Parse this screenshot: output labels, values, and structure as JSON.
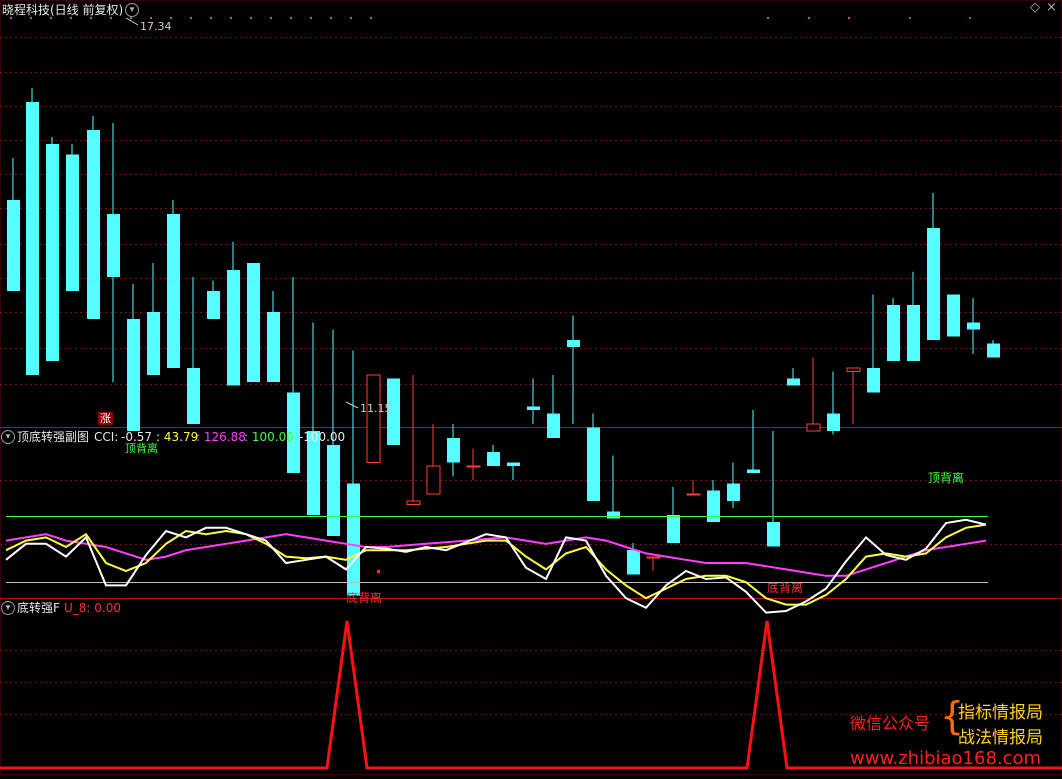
{
  "main": {
    "title": "晓程科技(日线 前复权)",
    "high_label": "17.34",
    "low_label": "11.15",
    "zhang_label": "涨",
    "candles": [
      [
        6,
        20,
        32,
        5,
        -6
      ],
      [
        25,
        48,
        52,
        22,
        -30
      ],
      [
        45,
        36,
        38,
        27,
        -26
      ],
      [
        65,
        33,
        36,
        12,
        -6
      ],
      [
        86,
        40,
        44,
        -10,
        -14
      ],
      [
        106,
        16,
        42,
        -32,
        -2
      ],
      [
        126,
        -14,
        -4,
        -43,
        -46
      ],
      [
        146,
        -12,
        2,
        -3,
        -30
      ],
      [
        166,
        16,
        20,
        0,
        -28
      ],
      [
        186,
        -28,
        -2,
        -34,
        -44
      ],
      [
        206,
        -6,
        -8,
        -3,
        -14
      ],
      [
        226,
        0,
        8,
        -11,
        -33
      ],
      [
        246,
        2,
        -2,
        -5,
        -32
      ],
      [
        266,
        -12,
        -6,
        -16,
        -32
      ],
      [
        286,
        -35,
        -2,
        -34,
        -58
      ],
      [
        306,
        -46,
        -15,
        -56,
        -70
      ],
      [
        326,
        -50,
        -17,
        -63,
        -76
      ],
      [
        346,
        -61,
        -23,
        -47,
        -93
      ],
      [
        366,
        -55,
        -43,
        -54,
        -30
      ],
      [
        386,
        -31,
        -49,
        -31,
        -50
      ],
      [
        406,
        -67,
        -30,
        -56,
        -66
      ],
      [
        426,
        -64,
        -46,
        -44,
        -56
      ],
      [
        446,
        -48,
        -44,
        -59,
        -55
      ],
      [
        466,
        -56,
        -51,
        -60,
        -56
      ],
      [
        486,
        -52,
        -55,
        -50,
        -56
      ],
      [
        506,
        -55,
        -60,
        -60,
        -56
      ],
      [
        526,
        -39,
        -31,
        -44,
        -40
      ],
      [
        546,
        -41,
        -30,
        -38,
        -48
      ],
      [
        566,
        -20,
        -13,
        -44,
        -22
      ],
      [
        586,
        -45,
        -54,
        -41,
        -66
      ],
      [
        606,
        -69,
        -58,
        -53,
        -71
      ],
      [
        626,
        -80,
        -82,
        -78,
        -87
      ],
      [
        646,
        -82,
        -85,
        -86,
        -82
      ],
      [
        666,
        -70,
        -62,
        -64,
        -78
      ],
      [
        686,
        -64,
        -60,
        -63,
        -64
      ],
      [
        706,
        -63,
        -61,
        -60,
        -72
      ],
      [
        726,
        -61,
        -55,
        -68,
        -66
      ],
      [
        746,
        -57,
        -40,
        -56,
        -58
      ],
      [
        766,
        -72,
        -46,
        -62,
        -79
      ],
      [
        786,
        -31,
        -33,
        -28,
        -33
      ],
      [
        806,
        -46,
        -25,
        -35,
        -44
      ],
      [
        826,
        -41,
        -29,
        -47,
        -46
      ],
      [
        846,
        -29,
        -44,
        -31,
        -28
      ],
      [
        866,
        -28,
        -7,
        -18,
        -35
      ],
      [
        886,
        -10,
        -20,
        -8,
        -26
      ],
      [
        906,
        -10,
        -0.5,
        -15,
        -26
      ],
      [
        926,
        12,
        22,
        13,
        -20
      ],
      [
        946,
        -7,
        -10,
        -17,
        -19
      ],
      [
        966,
        -15,
        -8,
        -24,
        -17
      ],
      [
        986,
        -21,
        -24,
        -20,
        -25
      ]
    ]
  },
  "indicator": {
    "title": "顶底转强副图",
    "cci_label": "CCI:",
    "cci_value": "-0.57",
    "v1": ": 43.79",
    "v2": ": 126.88",
    "v3": ": 100.00",
    "v4": ": -100.00",
    "top_div_label": "顶背离",
    "top_div_label_clipped": "顶背离",
    "bottom_div_label_1": "底背离",
    "bottom_div_label_2": "底背离",
    "white_line": [
      [
        6,
        -28
      ],
      [
        26,
        -18
      ],
      [
        46,
        -18
      ],
      [
        66,
        -26
      ],
      [
        86,
        -14
      ],
      [
        106,
        -44
      ],
      [
        126,
        -44
      ],
      [
        146,
        -25
      ],
      [
        166,
        -10
      ],
      [
        186,
        -14
      ],
      [
        206,
        -8
      ],
      [
        226,
        -8
      ],
      [
        246,
        -12
      ],
      [
        266,
        -16
      ],
      [
        286,
        -30
      ],
      [
        306,
        -28
      ],
      [
        326,
        -26
      ],
      [
        346,
        -34
      ],
      [
        366,
        -20
      ],
      [
        386,
        -21
      ],
      [
        406,
        -23
      ],
      [
        426,
        -20
      ],
      [
        446,
        -22
      ],
      [
        466,
        -17
      ],
      [
        486,
        -12
      ],
      [
        506,
        -14
      ],
      [
        526,
        -33
      ],
      [
        546,
        -40
      ],
      [
        566,
        -14
      ],
      [
        586,
        -16
      ],
      [
        606,
        -38
      ],
      [
        626,
        -52
      ],
      [
        646,
        -58
      ],
      [
        666,
        -44
      ],
      [
        686,
        -35
      ],
      [
        706,
        -40
      ],
      [
        726,
        -39
      ],
      [
        746,
        -48
      ],
      [
        766,
        -61
      ],
      [
        786,
        -60
      ],
      [
        806,
        -54
      ],
      [
        826,
        -46
      ],
      [
        846,
        -29
      ],
      [
        866,
        -14
      ],
      [
        886,
        -25
      ],
      [
        906,
        -28
      ],
      [
        926,
        -21
      ],
      [
        946,
        -5
      ],
      [
        966,
        -3
      ],
      [
        986,
        -6
      ]
    ],
    "yellow_line": [
      [
        6,
        -22
      ],
      [
        26,
        -16
      ],
      [
        46,
        -14
      ],
      [
        66,
        -20
      ],
      [
        86,
        -12
      ],
      [
        106,
        -30
      ],
      [
        126,
        -35
      ],
      [
        146,
        -30
      ],
      [
        166,
        -18
      ],
      [
        186,
        -10
      ],
      [
        206,
        -12
      ],
      [
        226,
        -10
      ],
      [
        246,
        -12
      ],
      [
        266,
        -18
      ],
      [
        286,
        -26
      ],
      [
        306,
        -27
      ],
      [
        326,
        -26
      ],
      [
        346,
        -28
      ],
      [
        366,
        -22
      ],
      [
        386,
        -22
      ],
      [
        406,
        -22
      ],
      [
        426,
        -21
      ],
      [
        446,
        -20
      ],
      [
        466,
        -18
      ],
      [
        486,
        -16
      ],
      [
        506,
        -16
      ],
      [
        526,
        -26
      ],
      [
        546,
        -34
      ],
      [
        566,
        -24
      ],
      [
        586,
        -20
      ],
      [
        606,
        -34
      ],
      [
        626,
        -44
      ],
      [
        646,
        -52
      ],
      [
        666,
        -46
      ],
      [
        686,
        -40
      ],
      [
        706,
        -38
      ],
      [
        726,
        -38
      ],
      [
        746,
        -42
      ],
      [
        766,
        -52
      ],
      [
        786,
        -56
      ],
      [
        806,
        -56
      ],
      [
        826,
        -50
      ],
      [
        846,
        -40
      ],
      [
        866,
        -26
      ],
      [
        886,
        -24
      ],
      [
        906,
        -26
      ],
      [
        926,
        -24
      ],
      [
        946,
        -14
      ],
      [
        966,
        -8
      ],
      [
        986,
        -6
      ]
    ],
    "magenta_line": [
      [
        6,
        -16
      ],
      [
        26,
        -14
      ],
      [
        46,
        -12
      ],
      [
        66,
        -16
      ],
      [
        86,
        -18
      ],
      [
        106,
        -20
      ],
      [
        126,
        -24
      ],
      [
        146,
        -28
      ],
      [
        166,
        -26
      ],
      [
        186,
        -22
      ],
      [
        206,
        -20
      ],
      [
        226,
        -18
      ],
      [
        246,
        -16
      ],
      [
        266,
        -14
      ],
      [
        286,
        -12
      ],
      [
        306,
        -14
      ],
      [
        326,
        -16
      ],
      [
        346,
        -18
      ],
      [
        366,
        -20
      ],
      [
        386,
        -20
      ],
      [
        406,
        -19
      ],
      [
        426,
        -18
      ],
      [
        446,
        -17
      ],
      [
        466,
        -16
      ],
      [
        486,
        -15
      ],
      [
        506,
        -14
      ],
      [
        526,
        -16
      ],
      [
        546,
        -18
      ],
      [
        566,
        -16
      ],
      [
        586,
        -14
      ],
      [
        606,
        -16
      ],
      [
        626,
        -20
      ],
      [
        646,
        -24
      ],
      [
        666,
        -26
      ],
      [
        686,
        -28
      ],
      [
        706,
        -30
      ],
      [
        726,
        -30
      ],
      [
        746,
        -30
      ],
      [
        766,
        -32
      ],
      [
        786,
        -34
      ],
      [
        806,
        -36
      ],
      [
        826,
        -38
      ],
      [
        846,
        -38
      ],
      [
        866,
        -34
      ],
      [
        886,
        -30
      ],
      [
        906,
        -26
      ],
      [
        926,
        -22
      ],
      [
        946,
        -20
      ],
      [
        966,
        -18
      ],
      [
        986,
        -16
      ]
    ]
  },
  "signal": {
    "title": "底转强F",
    "value_label": "U_8: 0.00",
    "spikes": [
      347,
      767
    ]
  },
  "watermark": {
    "line1": "微信公众号",
    "line2": "指标情报局",
    "line3": "战法情报局",
    "url": "www.zhibiao168.com"
  },
  "colors": {
    "bull": "#ff3b3b",
    "bear": "#54ffff",
    "white_line": "#ffffff",
    "yellow_line": "#ffff40",
    "magenta_line": "#ff40ff",
    "green_line": "#40ff40",
    "signal": "#ff1010",
    "grid": "#7a1010"
  }
}
